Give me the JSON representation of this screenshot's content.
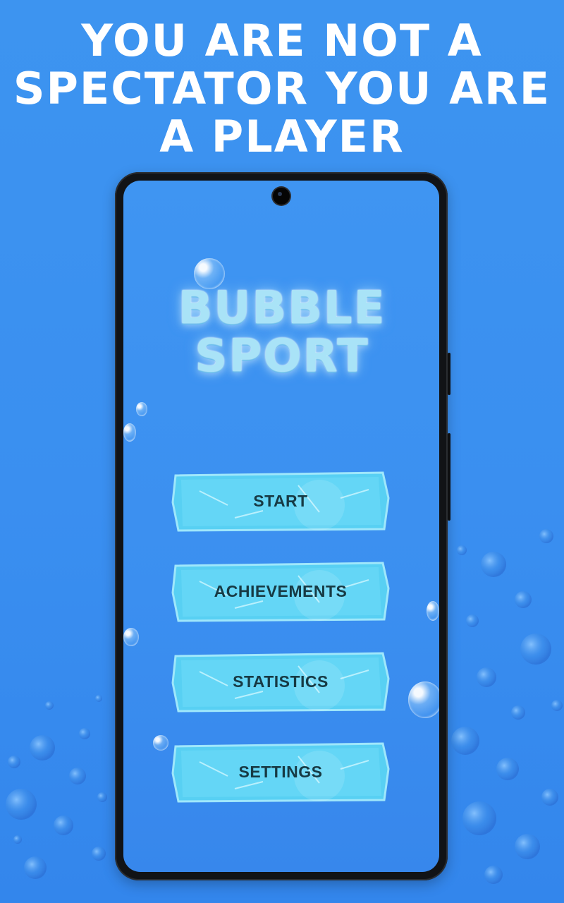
{
  "headline": {
    "line1": "YOU ARE NOT A",
    "line2": "SPECTATOR YOU ARE",
    "line3": "A PLAYER"
  },
  "app": {
    "logo_line1": "BUBBLE",
    "logo_line2": "SPORT"
  },
  "menu": {
    "items": [
      {
        "label": "START"
      },
      {
        "label": "ACHIEVEMENTS"
      },
      {
        "label": "STATISTICS"
      },
      {
        "label": "SETTINGS"
      }
    ]
  },
  "colors": {
    "background": "#3a8ff0",
    "headline_text": "#ffffff",
    "button_ice": "#58d0f3",
    "button_text": "#173a44",
    "logo_text": "#a9e3f7",
    "phone_frame": "#111316"
  },
  "icons": {
    "camera": "front-camera-icon",
    "bubbles": "bubble-icon"
  }
}
